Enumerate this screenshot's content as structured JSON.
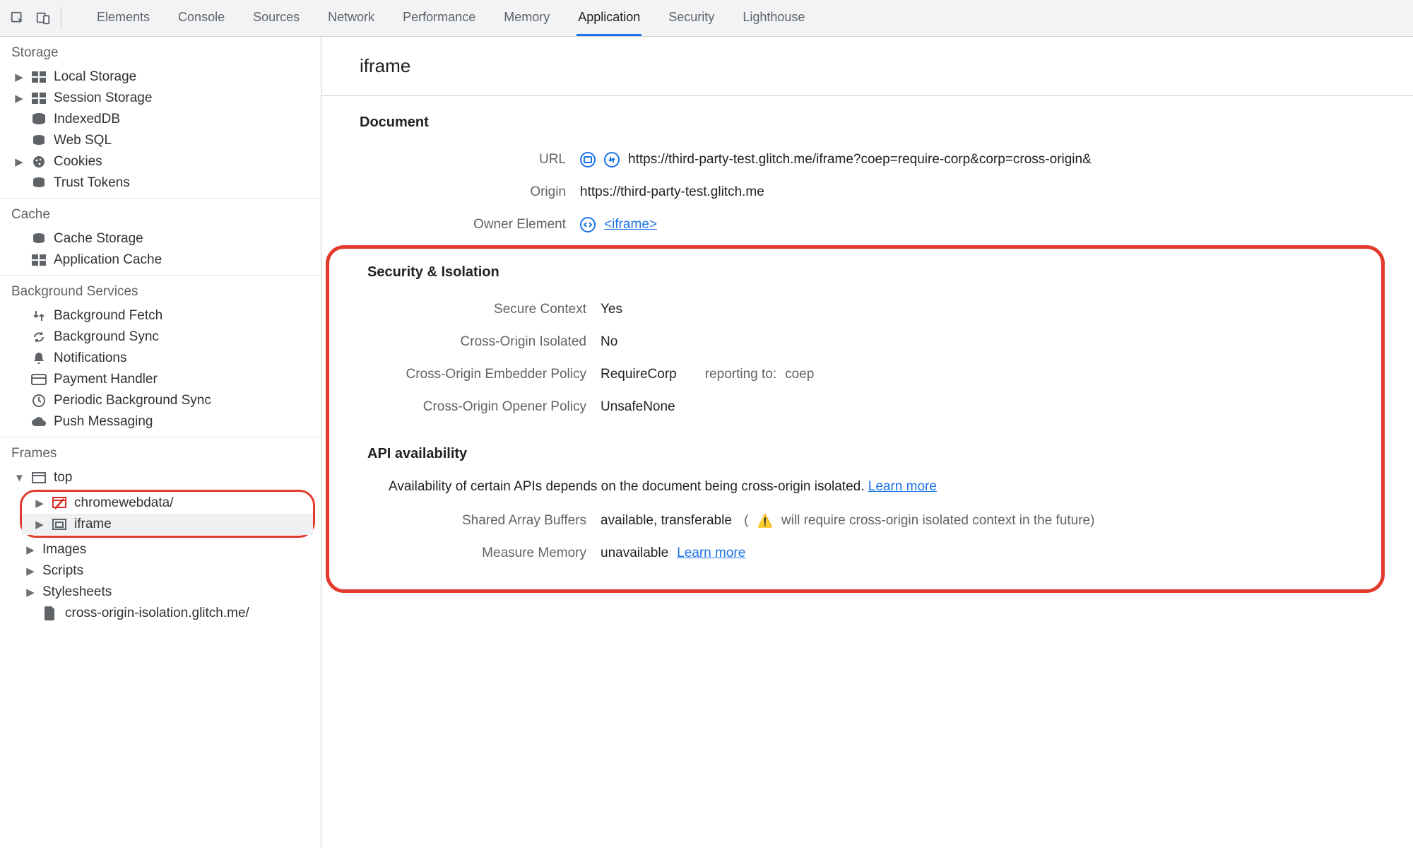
{
  "tabs": {
    "items": [
      "Elements",
      "Console",
      "Sources",
      "Network",
      "Performance",
      "Memory",
      "Application",
      "Security",
      "Lighthouse"
    ],
    "active": "Application"
  },
  "sidebar": {
    "storage": {
      "title": "Storage",
      "items": [
        "Local Storage",
        "Session Storage",
        "IndexedDB",
        "Web SQL",
        "Cookies",
        "Trust Tokens"
      ]
    },
    "cache": {
      "title": "Cache",
      "items": [
        "Cache Storage",
        "Application Cache"
      ]
    },
    "bgservices": {
      "title": "Background Services",
      "items": [
        "Background Fetch",
        "Background Sync",
        "Notifications",
        "Payment Handler",
        "Periodic Background Sync",
        "Push Messaging"
      ]
    },
    "frames": {
      "title": "Frames",
      "top": "top",
      "boxed": [
        "chromewebdata/",
        "iframe"
      ],
      "rest": [
        "Images",
        "Scripts",
        "Stylesheets",
        "cross-origin-isolation.glitch.me/"
      ]
    }
  },
  "main": {
    "title": "iframe",
    "doc": {
      "heading": "Document",
      "url_label": "URL",
      "url_value": "https://third-party-test.glitch.me/iframe?coep=require-corp&corp=cross-origin&",
      "origin_label": "Origin",
      "origin_value": "https://third-party-test.glitch.me",
      "owner_label": "Owner Element",
      "owner_value": "<iframe>"
    },
    "sec": {
      "heading": "Security & Isolation",
      "rows": {
        "secure_context": {
          "k": "Secure Context",
          "v": "Yes"
        },
        "coi": {
          "k": "Cross-Origin Isolated",
          "v": "No"
        },
        "coep": {
          "k": "Cross-Origin Embedder Policy",
          "v": "RequireCorp",
          "extra_label": "reporting to:",
          "extra_val": "coep"
        },
        "coop": {
          "k": "Cross-Origin Opener Policy",
          "v": "UnsafeNone"
        }
      }
    },
    "api": {
      "heading": "API availability",
      "intro": "Availability of certain APIs depends on the document being cross-origin isolated.",
      "learn_more": "Learn more",
      "sab": {
        "k": "Shared Array Buffers",
        "v": "available, transferable",
        "warn": "will require cross-origin isolated context in the future)"
      },
      "mm": {
        "k": "Measure Memory",
        "v": "unavailable",
        "learn": "Learn more"
      }
    }
  }
}
